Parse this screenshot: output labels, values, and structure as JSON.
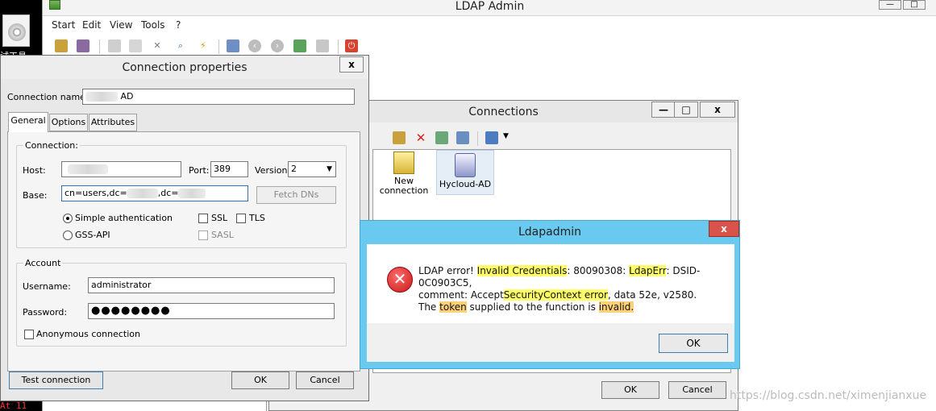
{
  "desktop": {
    "icon_label": "试工具",
    "bottom_text": "At 11"
  },
  "main_window": {
    "title": "LDAP Admin",
    "minimize": "—",
    "maximize": "□",
    "menu": [
      "Start",
      "Edit",
      "View",
      "Tools",
      "?"
    ]
  },
  "connections_window": {
    "title": "Connections",
    "minimize": "—",
    "maximize": "□",
    "close": "x",
    "items": [
      {
        "label_line1": "New",
        "label_line2": "connection",
        "icon": "new-connection-icon"
      },
      {
        "label_line1": "Hycloud-AD",
        "label_line2": "",
        "icon": "server-icon"
      }
    ],
    "ok_label": "OK",
    "cancel_label": "Cancel"
  },
  "connection_properties": {
    "title": "Connection properties",
    "close": "x",
    "connection_name_label": "Connection name:",
    "connection_name_value": "AD",
    "tabs": [
      "General",
      "Options",
      "Attributes"
    ],
    "connection_group": "Connection:",
    "host_label": "Host:",
    "port_label": "Port:",
    "port_value": "389",
    "version_label": "Version:",
    "version_value": "2",
    "base_label": "Base:",
    "base_value_1": "cn=users,dc=",
    "base_value_2": ",dc=",
    "fetch_dns": "Fetch DNs",
    "simple_auth": "Simple authentication",
    "gss_api": "GSS-API",
    "ssl": "SSL",
    "tls": "TLS",
    "sasl": "SASL",
    "account_group": "Account",
    "username_label": "Username:",
    "username_value": "administrator",
    "password_label": "Password:",
    "password_value": "●●●●●●●●",
    "anonymous": "Anonymous connection",
    "test_connection": "Test connection",
    "ok_label": "OK",
    "cancel_label": "Cancel"
  },
  "error_dialog": {
    "title": "Ldapadmin",
    "close": "x",
    "msg_prefix": "LDAP error! ",
    "msg_invalid_credentials": "Invalid Credentials",
    "msg_code": ": 80090308: ",
    "msg_ldaperr": "LdapErr",
    "msg_dsid": ": DSID-0C0903C5,",
    "msg_comment": "comment: Accept",
    "msg_security_context": "SecurityContext error",
    "msg_data": ", data 52e, v2580.",
    "msg_the": "The ",
    "msg_token": "token",
    "msg_supplied": " supplied to the function is ",
    "msg_invalid": "invalid.",
    "ok_label": "OK"
  },
  "watermark": "https://blog.csdn.net/ximenjianxue",
  "colors": {
    "error_title_bar": "#69c9ee",
    "error_close": "#d9534a",
    "highlight_yellow": "#ffff66",
    "highlight_orange": "#ffd27a"
  }
}
